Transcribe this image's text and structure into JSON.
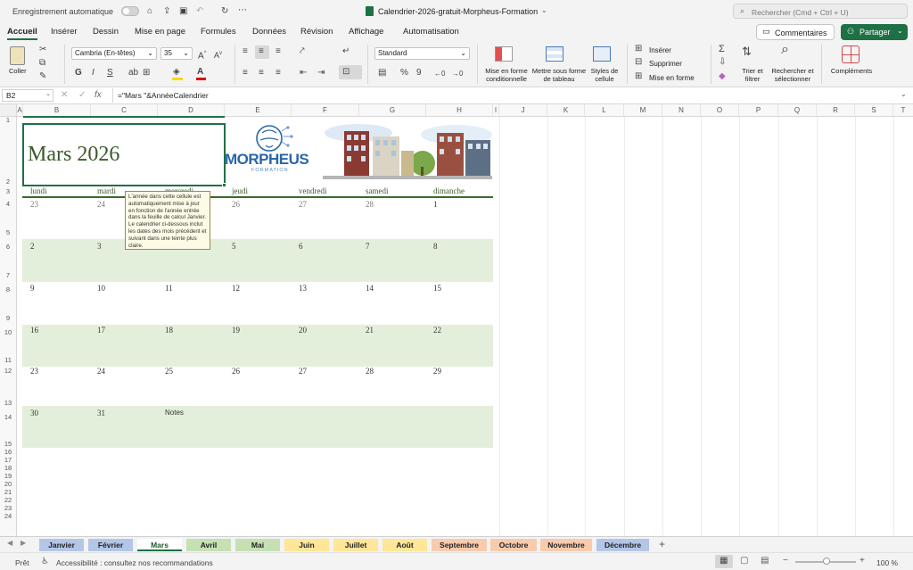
{
  "titlebar": {
    "autosave_label": "Enregistrement automatique",
    "file_title": "Calendrier-2026-gratuit-Morpheus-Formation",
    "search_placeholder": "Rechercher (Cmd + Ctrl + U)"
  },
  "ribbon_tabs": [
    "Accueil",
    "Insérer",
    "Dessin",
    "Mise en page",
    "Formules",
    "Données",
    "Révision",
    "Affichage",
    "Automatisation"
  ],
  "ribbon_right": {
    "comments_label": "Commentaires",
    "share_label": "Partager"
  },
  "ribbon": {
    "paste_label": "Coller",
    "font_name": "Cambria (En-têtes)",
    "font_size": "35",
    "number_format": "Standard",
    "cond_format_label": "Mise en forme conditionnelle",
    "table_format_label": "Mettre sous forme de tableau",
    "cell_styles_label": "Styles de cellule",
    "insert_label": "Insérer",
    "delete_label": "Supprimer",
    "format_label": "Mise en forme",
    "sort_filter_label": "Trier et filtrer",
    "find_select_label": "Rechercher et sélectionner",
    "addins_label": "Compléments"
  },
  "formula_bar": {
    "cell_ref": "B2",
    "fx": "fx",
    "formula": "=\"Mars \"&AnnéeCalendrier"
  },
  "columns": [
    "A",
    "B",
    "C",
    "D",
    "E",
    "F",
    "G",
    "H",
    "I",
    "J",
    "K",
    "L",
    "M",
    "N",
    "O",
    "P",
    "Q",
    "R",
    "S",
    "T"
  ],
  "rows": [
    "1",
    "2",
    "3",
    "4",
    "5",
    "6",
    "7",
    "8",
    "9",
    "10",
    "11",
    "12",
    "13",
    "14",
    "15",
    "16",
    "17",
    "18",
    "19",
    "20",
    "21",
    "22",
    "23",
    "24"
  ],
  "calendar": {
    "title": "Mars 2026",
    "logo_text": "MORPHEUS",
    "logo_sub": "FORMATION",
    "weekdays": [
      "lundi",
      "mardi",
      "mercredi",
      "jeudi",
      "vendredi",
      "samedi",
      "dimanche"
    ],
    "weeks": [
      [
        "23",
        "24",
        "25",
        "26",
        "27",
        "28",
        "1"
      ],
      [
        "2",
        "3",
        "4",
        "5",
        "6",
        "7",
        "8"
      ],
      [
        "9",
        "10",
        "11",
        "12",
        "13",
        "14",
        "15"
      ],
      [
        "16",
        "17",
        "18",
        "19",
        "20",
        "21",
        "22"
      ],
      [
        "23",
        "24",
        "25",
        "26",
        "27",
        "28",
        "29"
      ],
      [
        "30",
        "31",
        "Notes",
        "",
        "",
        "",
        ""
      ]
    ],
    "tooltip": "L'année dans cette cellule est automatiquement mise à jour en fonction de l'année entrée dans la feuille de calcul Janvier. Le calendrier ci-dessous inclut les dates des mois précédent et suivant dans une teinte plus claire."
  },
  "sheet_tabs": [
    {
      "label": "Janvier",
      "color": "#b4c6e7"
    },
    {
      "label": "Février",
      "color": "#b4c6e7"
    },
    {
      "label": "Mars",
      "color": "#c6e0b4"
    },
    {
      "label": "Avril",
      "color": "#c6e0b4"
    },
    {
      "label": "Mai",
      "color": "#c6e0b4"
    },
    {
      "label": "Juin",
      "color": "#ffe699"
    },
    {
      "label": "Juillet",
      "color": "#ffe699"
    },
    {
      "label": "Août",
      "color": "#ffe699"
    },
    {
      "label": "Septembre",
      "color": "#f8cbad"
    },
    {
      "label": "Octobre",
      "color": "#f8cbad"
    },
    {
      "label": "Novembre",
      "color": "#f8cbad"
    },
    {
      "label": "Décembre",
      "color": "#b4c6e7"
    }
  ],
  "status": {
    "ready": "Prêt",
    "accessibility": "Accessibilité : consultez nos recommandations",
    "zoom": "100 %"
  },
  "colors": {
    "accent": "#1e7145",
    "band": "#e4efdb",
    "title_green": "#3a5a2a"
  }
}
